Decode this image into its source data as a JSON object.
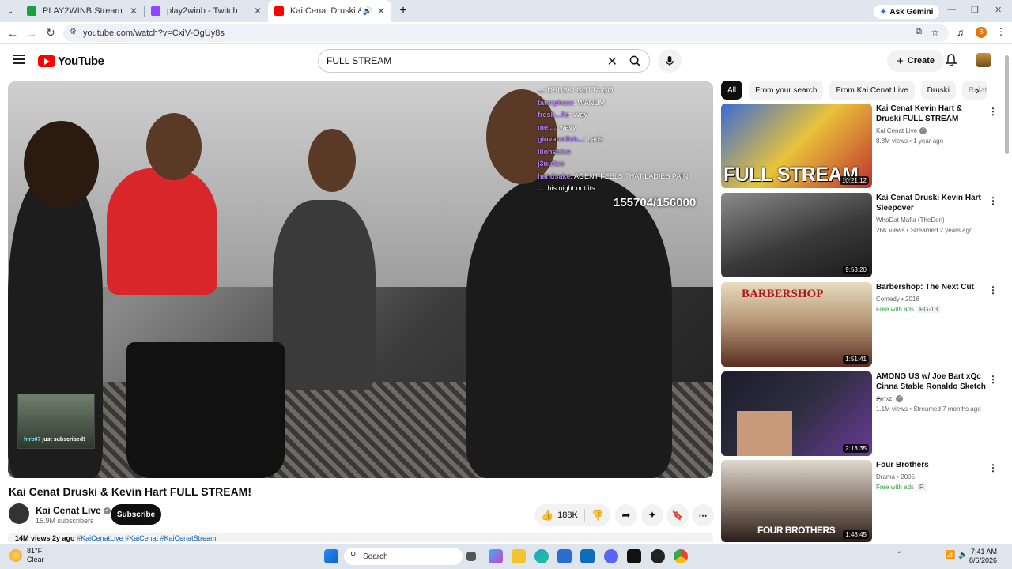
{
  "browser": {
    "tabs": [
      {
        "title": "PLAY2WINB Stream - Watch Li...",
        "favicon_color": "#1a9e3f"
      },
      {
        "title": "play2winb - Twitch",
        "favicon_color": "#9146ff"
      },
      {
        "title": "Kai Cenat Druski & Kevin H...",
        "favicon_color": "#ff0000"
      }
    ],
    "new_tab": "+",
    "ask_gemini": "Ask Gemini",
    "url": "youtube.com/watch?v=CxiV-OgUy8s",
    "profile_initial": "B"
  },
  "youtube": {
    "logo_text": "YouTube",
    "search_value": "FULL STREAM",
    "create_label": "Create"
  },
  "player": {
    "chat": [
      {
        "user": "...",
        "msg": "DRUSKI GOTTA GO"
      },
      {
        "user": "tatorphaze",
        "msg": "WANUM"
      },
      {
        "user": "fresh...0s",
        "msg": "vvay"
      },
      {
        "user": "mel...",
        "msg": "wayy"
      },
      {
        "user": "giovannifch...",
        "msg": "Lads"
      },
      {
        "user": "lilohshine",
        "msg": ""
      },
      {
        "user": "j3nu4xo",
        "msg": ""
      },
      {
        "user": "handsake",
        "msg": "AGENT FEELS THAT LADIES PAIN"
      },
      {
        "user": "...",
        "msg": "his night outfits"
      }
    ],
    "counter": "155704/156000",
    "sub_user": "fnrb07",
    "sub_text": "just subscribed!"
  },
  "video": {
    "title": "Kai Cenat Druski & Kevin Hart FULL STREAM!",
    "channel": "Kai Cenat Live",
    "subscribers": "15.9M subscribers",
    "subscribe_label": "Subscribe",
    "likes": "188K",
    "views_line": "14M views  2y ago",
    "hashtags": "#KaiCenatLive #KaiCenat #KaiCenatStream"
  },
  "chips": [
    "All",
    "From your search",
    "From Kai Cenat Live",
    "Druski",
    "Relat"
  ],
  "recommendations": [
    {
      "title": "Kai Cenat Kevin Hart & Druski FULL STREAM",
      "channel": "Kai Cenat Live",
      "verified": true,
      "meta": "8.8M views • 1 year ago",
      "duration": "10:21:12",
      "thumb_text": "FULL STREAM",
      "color_a": "#3a6bd6",
      "color_b": "#e8c33a"
    },
    {
      "title": "Kai Cenat Druski Kevin Hart Sleepover",
      "channel": "WhoDat Mafia (TheDon)",
      "verified": false,
      "meta": "26K views • Streamed 2 years ago",
      "duration": "9:53:20",
      "thumb_text": "",
      "color_a": "#5b5b5b",
      "color_b": "#2a2a2a"
    },
    {
      "title": "Barbershop: The Next Cut",
      "channel": "Comedy • 2016",
      "verified": false,
      "free": "Free with ads",
      "rating": "PG-13",
      "duration": "1:51:41",
      "thumb_text": "BARBERSHOP",
      "color_a": "#d9c9a8",
      "color_b": "#7a3b2a"
    },
    {
      "title": "AMONG US w/ Joe Bart xQc Cinna Stable Ronaldo Sketch ...",
      "channel": "Jynxzi",
      "verified": true,
      "meta": "1.1M views • Streamed 7 months ago",
      "duration": "2:13:35",
      "thumb_text": "",
      "color_a": "#1c1c2a",
      "color_b": "#6a3a9a"
    },
    {
      "title": "Four Brothers",
      "channel": "Drama • 2005",
      "verified": false,
      "free": "Free with ads",
      "rating": "R",
      "duration": "1:48:45",
      "thumb_text": "FOUR BROTHERS",
      "color_a": "#d8d0c8",
      "color_b": "#3a2a22"
    }
  ],
  "taskbar": {
    "temp": "81°F",
    "condition": "Clear",
    "search_label": "Search",
    "time": "7:41 AM",
    "date": "8/6/2026"
  }
}
